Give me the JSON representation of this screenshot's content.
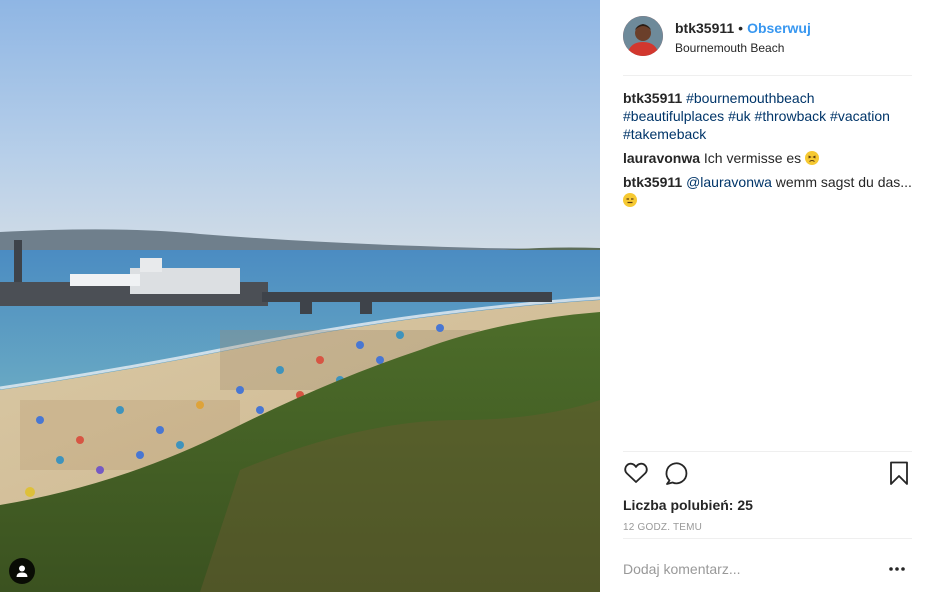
{
  "post": {
    "username": "btk35911",
    "follow_label": "Obserwuj",
    "separator": "•",
    "location": "Bournemouth Beach"
  },
  "comments": [
    {
      "user": "btk35911",
      "tags": [
        "#bournemouthbeach",
        "#beautifulplaces",
        "#uk",
        "#throwback",
        "#vacation",
        "#takemeback"
      ]
    },
    {
      "user": "lauravonwa",
      "text": "Ich vermisse es",
      "emoji": "persevering-face"
    },
    {
      "user": "btk35911",
      "mention": "@lauravonwa",
      "text": "wemm sagst du das...",
      "emoji": "expressionless-face"
    }
  ],
  "actions": {
    "like_icon": "heart-icon",
    "comment_icon": "speech-bubble-icon",
    "save_icon": "bookmark-icon",
    "likes_text": "Liczba polubień: 25",
    "time_ago": "12 GODZ. TEMU"
  },
  "add_comment": {
    "placeholder": "Dodaj komentarz...",
    "more_icon": "more-options-icon"
  },
  "photo": {
    "user_tags_icon": "user-tag-icon"
  }
}
